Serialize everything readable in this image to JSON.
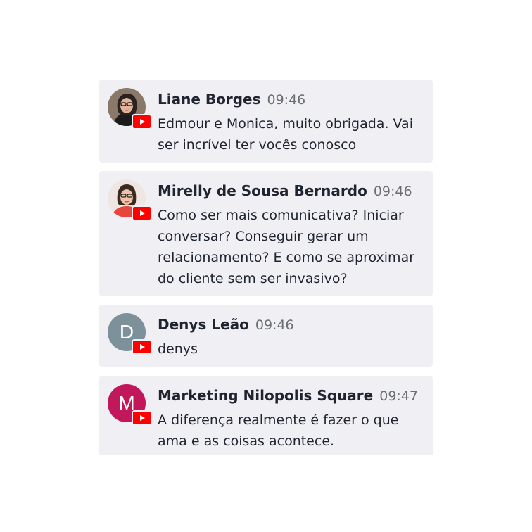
{
  "messages": [
    {
      "name": "Liane Borges",
      "time": "09:46",
      "text": "Edmour e Monica, muito obrigada. Vai ser incrível ter vocês conosco",
      "avatar_type": "photo",
      "avatar_icon": "user-photo-icon"
    },
    {
      "name": "Mirelly de Sousa Bernardo",
      "time": "09:46",
      "text": "Como ser mais comunicativa? Iniciar conversar? Conseguir gerar um relacionamento? E como se aproximar do cliente sem ser invasivo?",
      "avatar_type": "photo",
      "avatar_icon": "user-photo-icon"
    },
    {
      "name": "Denys Leão",
      "time": "09:46",
      "text": "denys",
      "avatar_type": "letter",
      "avatar_letter": "D",
      "avatar_color": "#7d919a"
    },
    {
      "name": "Marketing Nilopolis Square",
      "time": "09:47",
      "text": "A diferença realmente é fazer o que ama e as coisas acontece.",
      "avatar_type": "letter",
      "avatar_letter": "M",
      "avatar_color": "#c2185b"
    }
  ],
  "badge_icon": "youtube-icon",
  "colors": {
    "card_bg": "#f0f0f4",
    "youtube_red": "#ff0000",
    "name_text": "#1f2430",
    "time_text": "#6b6e75"
  }
}
